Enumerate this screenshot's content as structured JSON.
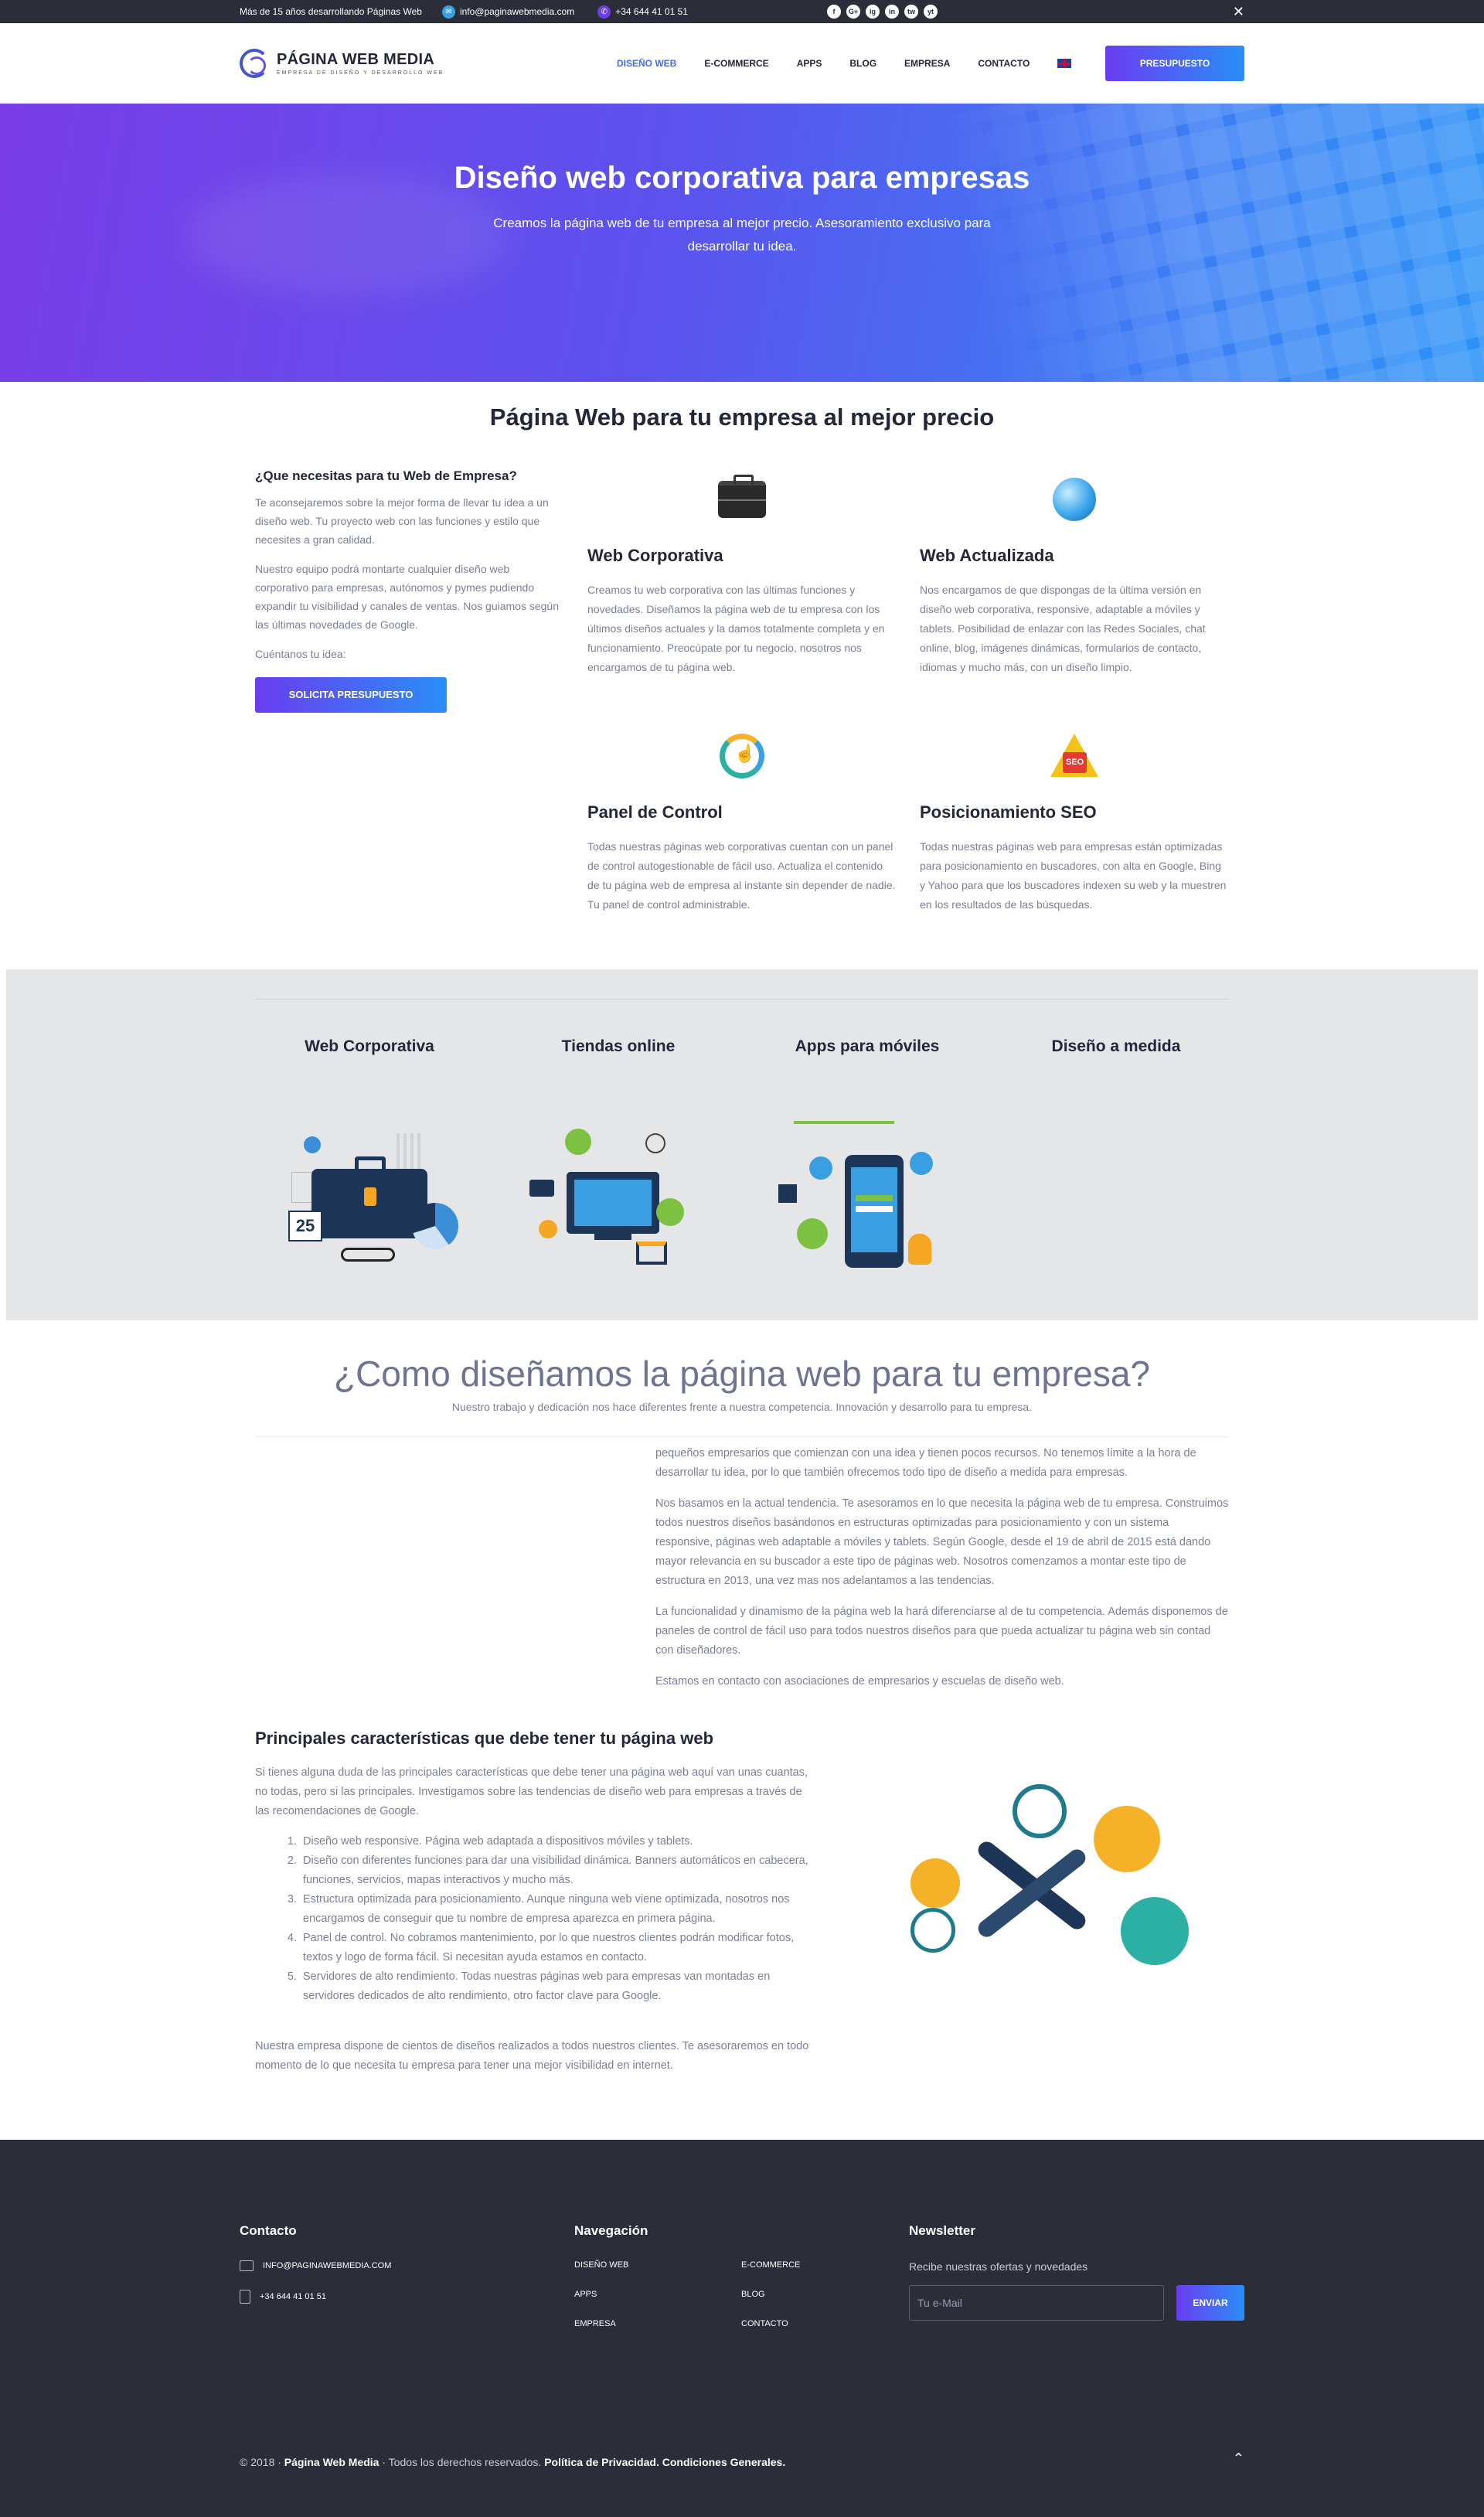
{
  "topbar": {
    "tagline": "Más de 15 años desarrollando Páginas Web",
    "email": "info@paginawebmedia.com",
    "phone": "+34 644 41 01 51",
    "socials": [
      "f",
      "G+",
      "ig",
      "in",
      "tw",
      "yt"
    ],
    "close": "✕"
  },
  "header": {
    "brand": "PÁGINA WEB MEDIA",
    "brand_sub": "EMPRESA DE DISEÑO Y DESARROLLO WEB",
    "nav": [
      "DISEÑO WEB",
      "E-COMMERCE",
      "APPS",
      "BLOG",
      "EMPRESA",
      "CONTACTO"
    ],
    "cta": "PRESUPUESTO"
  },
  "hero": {
    "title": "Diseño web corporativa para empresas",
    "subtitle": "Creamos la página web de tu empresa al mejor precio. Asesoramiento exclusivo para desarrollar tu idea."
  },
  "intro": {
    "heading": "Página Web para tu empresa al mejor precio",
    "left_title": "¿Que necesitas para tu Web de Empresa?",
    "left_p1": "Te aconsejaremos sobre la mejor forma de llevar tu idea a un diseño web. Tu proyecto web con las funciones y estilo que necesites a gran calidad.",
    "left_p2": "Nuestro equipo podrá montarte cualquier diseño web corporativo para empresas, autónomos y pymes pudiendo expandir tu visibilidad y canales de ventas. Nos guiamos según las últimas novedades de Google.",
    "left_p3": "Cuéntanos tu idea:",
    "button": "SOLICITA PRESUPUESTO",
    "features": [
      {
        "title": "Web Corporativa",
        "icon": "briefcase-icon",
        "text": "Creamos tu web corporativa con las últimas funciones y novedades. Diseñamos la página web de tu empresa con los últimos diseños actuales y la damos totalmente completa y en funcionamiento. Preocúpate por tu negocio, nosotros nos encargamos de tu página web."
      },
      {
        "title": "Web Actualizada",
        "icon": "globe-icon",
        "text": "Nos encargamos de que dispongas de la última versión en diseño web corporativa, responsive, adaptable a móviles y tablets. Posibilidad de enlazar con las Redes Sociales, chat online, blog, imágenes dinámicas, formularios de contacto, idiomas y mucho más, con un diseño limpio."
      },
      {
        "title": "Panel de Control",
        "icon": "refresh-hand-icon",
        "text": "Todas nuestras páginas web corporativas cuentan con un panel de control autogestionable de fácil uso. Actualiza el contenido de tu página web de empresa al instante sin depender de nadie. Tu panel de control administrable."
      },
      {
        "title": "Posicionamiento SEO",
        "icon": "seo-triangle-icon",
        "text": "Todas nuestras páginas web para empresas están optimizadas para posicionamiento en buscadores, con alta en Google, Bing y Yahoo para que los buscadores indexen su web y la muestren en los resultados de las búsquedas."
      }
    ]
  },
  "categories": [
    {
      "title": "Web Corporativa",
      "icon": "briefcase-illustration",
      "num": "25"
    },
    {
      "title": "Tiendas online",
      "icon": "online-store-illustration"
    },
    {
      "title": "Apps para móviles",
      "icon": "mobile-app-illustration"
    },
    {
      "title": "Diseño a medida",
      "icon": "custom-design-illustration"
    }
  ],
  "how": {
    "heading": "¿Como diseñamos la página web para tu empresa?",
    "lead": "Nuestro trabajo y dedicación nos hace diferentes frente a nuestra competencia. Innovación y desarrollo para tu empresa.",
    "p1": "pequeños empresarios que comienzan con una idea y tienen pocos recursos. No tenemos límite a la hora de desarrollar tu idea, por lo que también ofrecemos todo tipo de diseño a medida para empresas.",
    "p2": "Nos basamos en la actual tendencia. Te asesoramos en lo que necesita la página web de tu empresa. Construimos todos nuestros diseños basándonos en estructuras optimizadas para posicionamiento y con un sistema responsive, páginas web adaptable a móviles y tablets. Según Google, desde el 19 de abril de 2015 está dando mayor relevancia en su buscador a este tipo de páginas web. Nosotros comenzamos a montar este tipo de estructura en 2013, una vez mas nos adelantamos a las tendencias.",
    "p3": "La funcionalidad y dinamismo de la página web la hará diferenciarse al de tu competencia. Además disponemos de paneles de control de fácil uso para todos nuestros diseños para que pueda actualizar tu página web sin contad con diseñadores.",
    "p4": "Estamos en contacto con asociaciones de empresarios y escuelas de diseño web."
  },
  "chars": {
    "heading": "Principales características que debe tener tu página web",
    "intro": "Si tienes alguna duda de las principales características que debe tener una página web aquí van unas cuantas, no todas, pero si las principales. Investigamos sobre las tendencias de diseño web para empresas a través de las recomendaciones de Google.",
    "items": [
      "Diseño web responsive. Página web adaptada a dispositivos móviles y tablets.",
      "Diseño con diferentes funciones para dar una visibilidad dinámica. Banners automáticos en cabecera, funciones, servicios, mapas interactivos y mucho más.",
      "Estructura optimizada para posicionamiento. Aunque ninguna web viene optimizada, nosotros nos encargamos de conseguir que tu nombre de empresa aparezca en primera página.",
      "Panel de control. No cobramos mantenimiento, por lo que nuestros clientes podrán modificar fotos, textos y logo de forma fácil. Si necesitan ayuda estamos en contacto.",
      "Servidores de alto rendimiento. Todas nuestras páginas web para empresas van montadas en servidores dedicados de alto rendimiento, otro factor clave para Google."
    ],
    "outro": "Nuestra empresa dispone de cientos de diseños realizados a todos nuestros clientes. Te asesoraremos en todo momento de lo que necesita tu empresa para tener una mejor visibilidad en internet."
  },
  "footer": {
    "contact_title": "Contacto",
    "email": "INFO@PAGINAWEBMEDIA.COM",
    "phone": "+34 644 41 01 51",
    "nav_title": "Navegación",
    "nav": [
      "DISEÑO WEB",
      "E-COMMERCE",
      "APPS",
      "BLOG",
      "EMPRESA",
      "CONTACTO"
    ],
    "news_title": "Newsletter",
    "news_text": "Recibe nuestras ofertas y novedades",
    "news_placeholder": "Tu e-Mail",
    "news_button": "ENVIAR",
    "copy_year": "© 2018 ·",
    "copy_brand": "Página Web Media",
    "copy_rights": "· Todos los derechos reservados.",
    "privacy": "Política de Privacidad.",
    "terms": "Condiciones Generales.",
    "to_top": "⌃"
  },
  "colors": {
    "accent_start": "#6a3df0",
    "accent_end": "#2a8ef8",
    "dark": "#2b2d38",
    "band": "#e5e6e8"
  }
}
